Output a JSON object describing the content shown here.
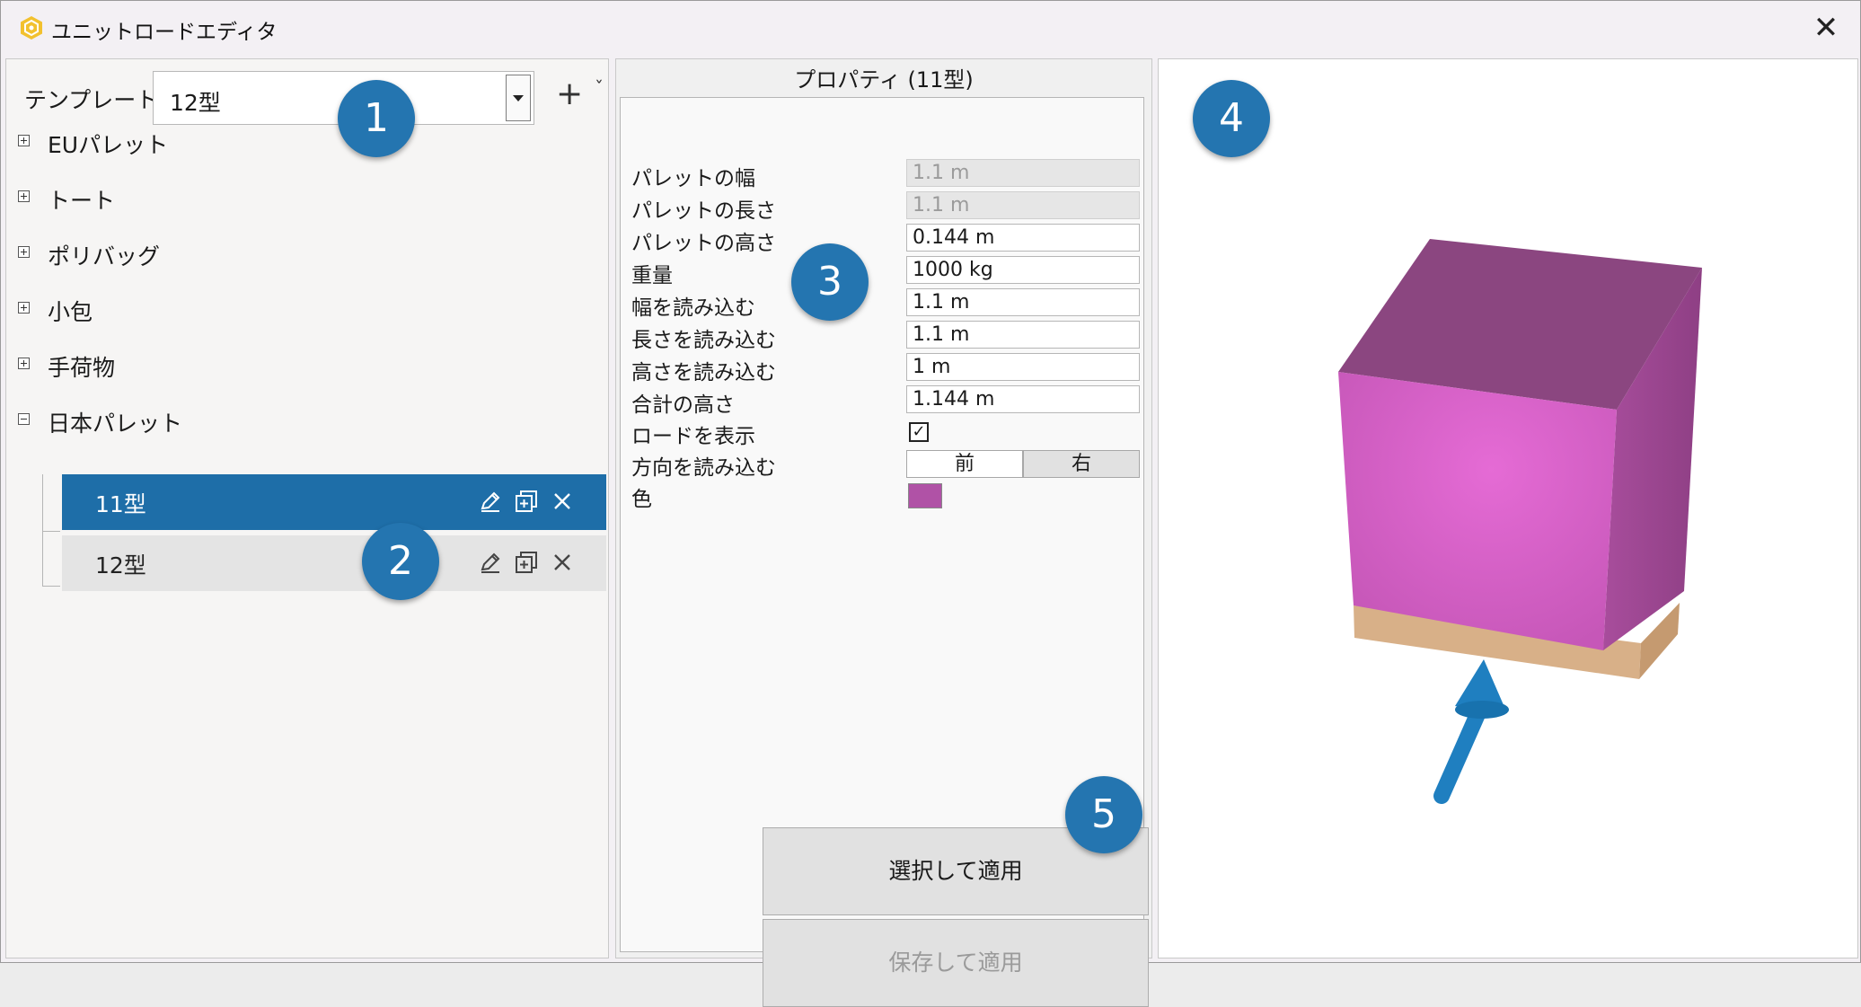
{
  "window": {
    "title": "ユニットロードエディタ",
    "close_icon": "close-icon"
  },
  "left": {
    "template_label": "テンプレート",
    "template_value": "12型",
    "tree": [
      {
        "label": "EUパレット",
        "expanded": false
      },
      {
        "label": "トート",
        "expanded": false
      },
      {
        "label": "ポリバッグ",
        "expanded": false
      },
      {
        "label": "小包",
        "expanded": false
      },
      {
        "label": "手荷物",
        "expanded": false
      },
      {
        "label": "日本パレット",
        "expanded": true
      }
    ],
    "children": [
      {
        "label": "11型",
        "selected": true
      },
      {
        "label": "12型",
        "selected": false
      }
    ]
  },
  "properties": {
    "title": "プロパティ (11型)",
    "rows": [
      {
        "label": "パレットの幅",
        "value": "1.1 m"
      },
      {
        "label": "パレットの長さ",
        "value": "1.1 m"
      },
      {
        "label": "パレットの高さ",
        "value": "0.144 m"
      },
      {
        "label": "重量",
        "value": "1000 kg"
      },
      {
        "label": "幅を読み込む",
        "value": "1.1 m"
      },
      {
        "label": "長さを読み込む",
        "value": "1.1 m"
      },
      {
        "label": "高さを読み込む",
        "value": "1 m"
      },
      {
        "label": "合計の高さ",
        "value": "1.144 m"
      }
    ],
    "show_load_label": "ロードを表示",
    "show_load_checked": true,
    "direction_label": "方向を読み込む",
    "direction_front": "前",
    "direction_right": "右",
    "color_label": "色",
    "color_value": "#b052a6",
    "apply_selected": "選択して適用",
    "save_apply": "保存して適用"
  },
  "callouts": [
    "1",
    "2",
    "3",
    "4",
    "5"
  ],
  "colors": {
    "accent": "#1e6ea8",
    "callout": "#2475b0",
    "load_top": "#8b4680",
    "load_front": "#de69cf",
    "pallet": "#d8b088"
  }
}
